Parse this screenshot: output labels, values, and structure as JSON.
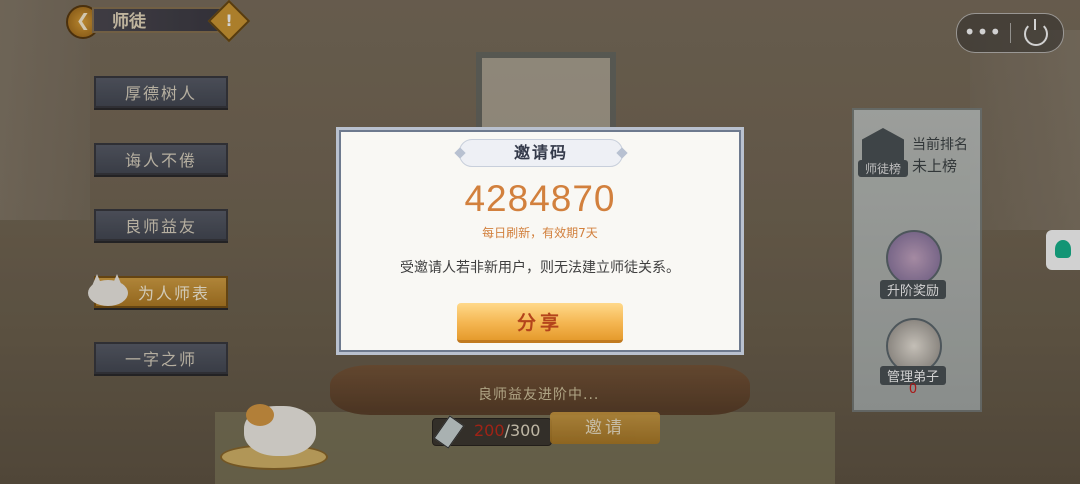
{
  "header": {
    "back_icon": "back-arrow-icon",
    "title": "师徒",
    "help_icon": "exclamation-icon"
  },
  "capsule": {
    "more_label": "•••",
    "close_icon": "power-icon"
  },
  "menu": {
    "items": [
      {
        "label": "厚德树人",
        "active": false
      },
      {
        "label": "诲人不倦",
        "active": false
      },
      {
        "label": "良师益友",
        "active": false
      },
      {
        "label": "为人师表",
        "active": true
      },
      {
        "label": "一字之师",
        "active": false
      }
    ]
  },
  "rank": {
    "badge_label": "师徒榜",
    "title": "当前排名",
    "value": "未上榜",
    "reward_label": "升阶奖励",
    "disciple_label": "管理弟子",
    "disciple_count": "0"
  },
  "progress": {
    "label": "良师益友进阶中...",
    "current": "200",
    "separator": "/",
    "max": "300",
    "fraction": 0.667,
    "invite_label": "邀请"
  },
  "modal": {
    "title": "邀请码",
    "code": "4284870",
    "refresh_note": "每日刷新，有效期7天",
    "rule": "受邀请人若非新用户，则无法建立师徒关系。",
    "share_label": "分享"
  },
  "colors": {
    "accent": "#d2803d",
    "button_gold": "#f4b550",
    "menu_active": "#d6a245"
  }
}
